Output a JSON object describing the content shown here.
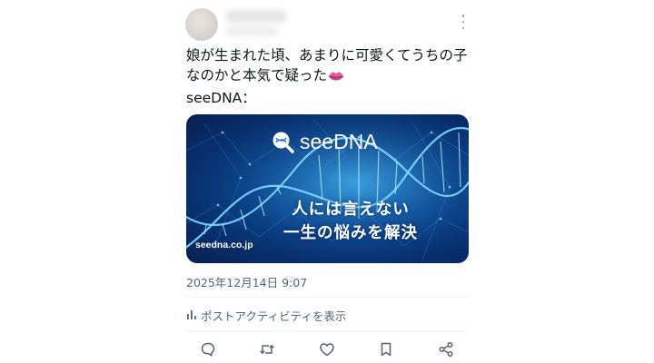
{
  "post": {
    "text_lines": [
      "娘が生まれた頃、あまりに可愛くてうちの子",
      "なのかと本気で疑った",
      "seeDNA："
    ],
    "media": {
      "brand": "seeDNA",
      "headline_lines": [
        "人には言えない",
        "一生の悩みを解決"
      ],
      "domain": "seedna.co.jp"
    },
    "timestamp": "2025年12月14日 9:07",
    "activity_label": "ポストアクティビティを表示"
  },
  "icons": {
    "more": "more-vertical-icon",
    "emoji": "kiss-mark-icon",
    "activity": "bar-chart-icon",
    "actions": [
      "reply-icon",
      "repost-icon",
      "like-icon",
      "bookmark-icon",
      "share-icon"
    ]
  },
  "colors": {
    "text": "#0f1419",
    "secondary": "#536471",
    "card_blue": "#0a3f86"
  }
}
